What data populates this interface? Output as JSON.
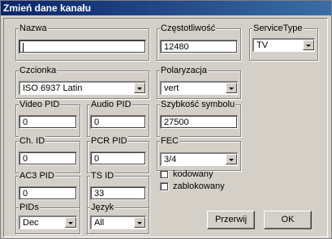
{
  "window": {
    "title": "Zmień dane kanału"
  },
  "groups": {
    "nazwa": "Nazwa",
    "czestotliwosc": "Częstotliwość",
    "service_type": "ServiceType",
    "czcionka": "Czcionka",
    "polaryzacja": "Polaryzacja",
    "video_pid": "Video PID",
    "audio_pid": "Audio PID",
    "szybkosc_symbolu": "Szybkość symbolu",
    "ch_id": "Ch. ID",
    "pcr_pid": "PCR PID",
    "fec": "FEC",
    "ac3_pid": "AC3 PID",
    "ts_id": "TS ID",
    "pids": "PIDs",
    "jezyk": "Język"
  },
  "values": {
    "nazwa": "",
    "czestotliwosc": "12480",
    "service_type": "TV",
    "czcionka": "ISO 6937 Latin",
    "polaryzacja": "vert",
    "video_pid": "0",
    "audio_pid": "0",
    "szybkosc_symbolu": "27500",
    "ch_id": "0",
    "pcr_pid": "0",
    "fec": "3/4",
    "ac3_pid": "0",
    "ts_id": "33",
    "pids": "Dec",
    "jezyk": "All"
  },
  "checkboxes": {
    "kodowany": {
      "label": "kodowany",
      "checked": false
    },
    "zablokowany": {
      "label": "zablokowany",
      "checked": false
    }
  },
  "buttons": {
    "cancel": "Przerwij",
    "ok": "OK"
  }
}
